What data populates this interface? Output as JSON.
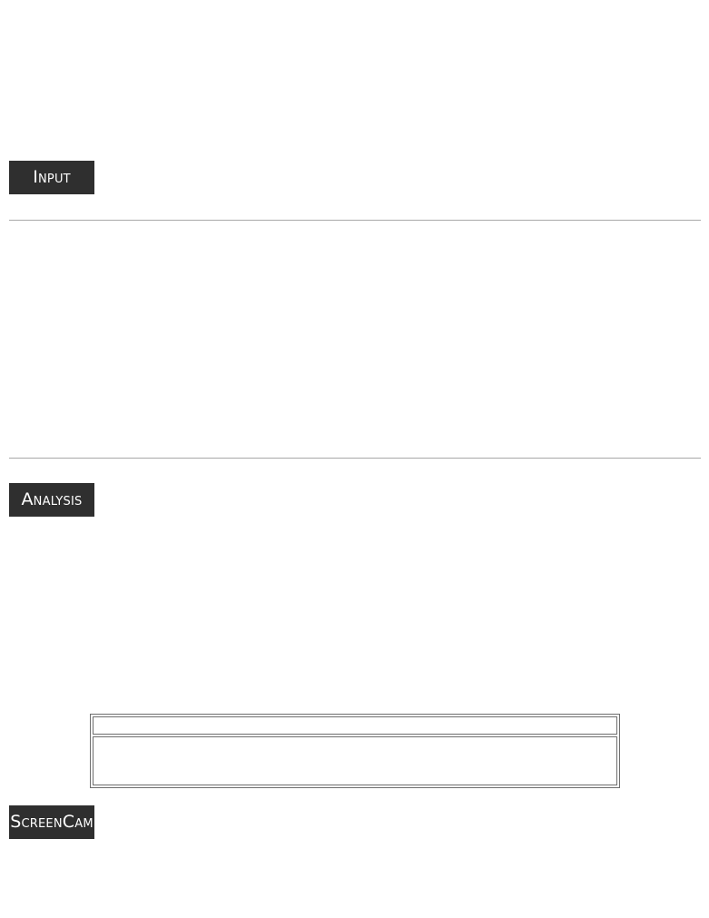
{
  "sections": {
    "input_label": "Input",
    "analysis_label": "Analysis",
    "screencam_label": "ScreenCam"
  },
  "table": {
    "header_text": "",
    "body_text": ""
  }
}
